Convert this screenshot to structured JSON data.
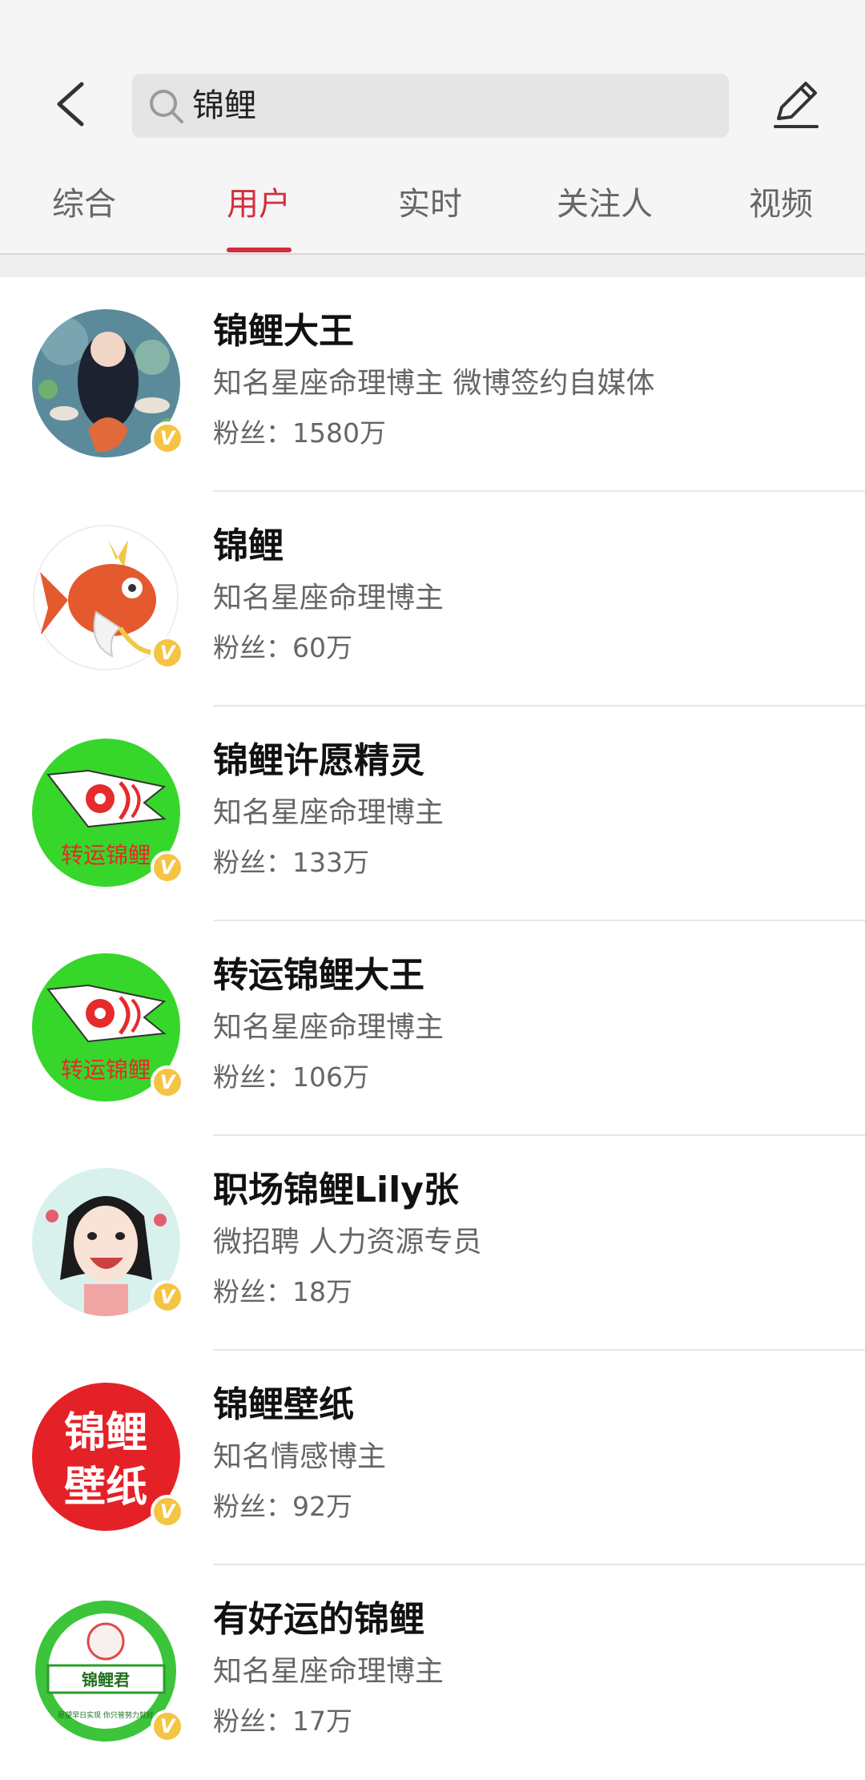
{
  "search": {
    "query": "锦鲤"
  },
  "tabs": [
    {
      "label": "综合"
    },
    {
      "label": "用户"
    },
    {
      "label": "实时"
    },
    {
      "label": "关注人"
    },
    {
      "label": "视频"
    }
  ],
  "active_tab": "用户",
  "accent_color": "#d22e3b",
  "badge_label": "V",
  "users": [
    {
      "name": "锦鲤大王",
      "desc": "知名星座命理博主 微博签约自媒体",
      "fans": "粉丝：1580万",
      "avatar_icon": "mermaid-avatar"
    },
    {
      "name": "锦鲤",
      "desc": "知名星座命理博主",
      "fans": "粉丝：60万",
      "avatar_icon": "magikarp-avatar"
    },
    {
      "name": "锦鲤许愿精灵",
      "desc": "知名星座命理博主",
      "fans": "粉丝：133万",
      "avatar_icon": "koi-windsock-avatar",
      "avatar_text": "转运锦鲤"
    },
    {
      "name": "转运锦鲤大王",
      "desc": "知名星座命理博主",
      "fans": "粉丝：106万",
      "avatar_icon": "koi-windsock-avatar",
      "avatar_text": "转运锦鲤"
    },
    {
      "name": "职场锦鲤Lily张",
      "desc": "微招聘 人力资源专员",
      "fans": "粉丝：18万",
      "avatar_icon": "cartoon-girl-avatar"
    },
    {
      "name": "锦鲤壁纸",
      "desc": "知名情感博主",
      "fans": "粉丝：92万",
      "avatar_icon": "text-avatar",
      "avatar_text_1": "锦鲤",
      "avatar_text_2": "壁纸"
    },
    {
      "name": "有好运的锦鲤",
      "desc": "知名星座命理博主",
      "fans": "粉丝：17万",
      "avatar_icon": "koi-badge-avatar",
      "avatar_text": "锦鲤君",
      "avatar_subtext": "愿望早日实现 你只管努力就好"
    }
  ]
}
